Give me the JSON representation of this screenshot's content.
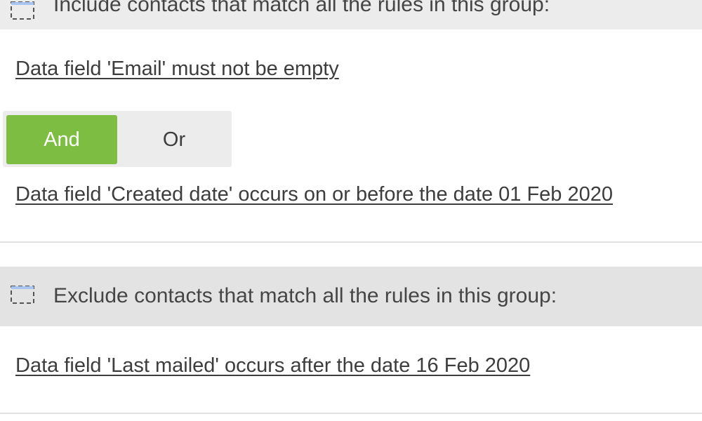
{
  "groups": [
    {
      "header_text": "Include contacts that match all the rules in this group:",
      "rules": [
        "Data field 'Email' must not be empty",
        "Data field 'Created date' occurs on or before the date 01 Feb 2020"
      ],
      "operator": {
        "options": [
          "And",
          "Or"
        ],
        "selected": "And"
      },
      "icon": "group-checkbox-icon"
    },
    {
      "header_text": "Exclude contacts that match all the rules in this group:",
      "rules": [
        "Data field 'Last mailed' occurs after the date 16 Feb 2020"
      ],
      "icon": "group-checkbox-icon"
    }
  ],
  "colors": {
    "selected_toggle": "#7cbd42",
    "header_background": "#e9e9e9",
    "icon_accent": "#a8c4f0"
  }
}
